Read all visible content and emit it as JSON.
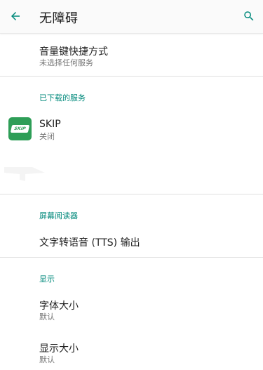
{
  "appbar": {
    "title": "无障碍",
    "back_icon": "arrow-back-icon",
    "search_icon": "search-icon",
    "accent": "#00897b"
  },
  "shortcut": {
    "title": "音量键快捷方式",
    "summary": "未选择任何服务"
  },
  "downloaded_services": {
    "header": "已下载的服务",
    "items": [
      {
        "title": "SKIP",
        "summary": "关闭",
        "icon_text": "SKIP"
      }
    ]
  },
  "screen_readers": {
    "header": "屏幕阅读器",
    "tts": {
      "title": "文字转语音 (TTS) 输出"
    }
  },
  "display": {
    "header": "显示",
    "font_size": {
      "title": "字体大小",
      "summary": "默认"
    },
    "display_size": {
      "title": "显示大小",
      "summary": "默认"
    }
  }
}
